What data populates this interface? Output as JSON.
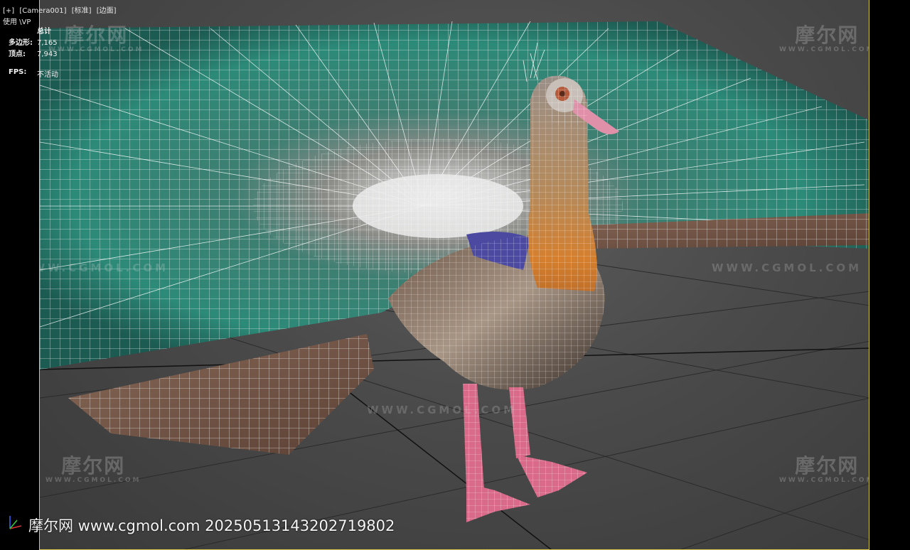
{
  "viewport": {
    "label_plus": "[+]",
    "label_camera": "[Camera001]",
    "label_shading": "[标准]",
    "label_mode": "[边面]",
    "sub_label": "使用 \\VP"
  },
  "stats": {
    "total_label": "总计",
    "polys_label": "多边形:",
    "polys_value": "7,165",
    "verts_label": "顶点:",
    "verts_value": "7,943",
    "fps_label": "FPS:",
    "fps_value": "不活动"
  },
  "watermark": {
    "brand": "摩尔网",
    "url_small": "WWW.CGMOL.COM",
    "url_wide": "WWW.CGMOL.COM"
  },
  "footer": {
    "credit": "摩尔网 www.cgmol.com 20250513143202719802"
  },
  "colors": {
    "frame_border": "#d8c84a",
    "feather_teal": "#2f8a77",
    "feather_brown": "#7a5a48",
    "body_orange": "#c9782e",
    "leg_pink": "#d96a8a"
  },
  "icons": [
    "axis-gizmo-icon"
  ]
}
